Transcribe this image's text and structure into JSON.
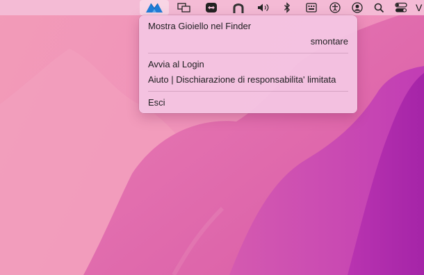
{
  "menubar": {
    "icons": [
      "gioiello-app-icon",
      "display-mirroring-icon",
      "teamviewer-icon",
      "vpn-icon",
      "volume-icon",
      "bluetooth-icon",
      "keyboard-input-icon",
      "accessibility-icon",
      "user-account-icon",
      "spotlight-search-icon",
      "control-center-icon"
    ],
    "clock_partial": "V"
  },
  "menu": {
    "items": [
      {
        "label": "Mostra Gioiello nel Finder"
      },
      {
        "label": "smontare"
      },
      {
        "label": "Avvia al Login"
      },
      {
        "label": "Aiuto | Dischiarazione di responsabilita' limitata"
      },
      {
        "label": "Esci"
      }
    ]
  },
  "colors": {
    "wallpaper_light": "#f29bb8",
    "wallpaper_mid": "#df6aa8",
    "wallpaper_dark": "#b833b0",
    "app_icon_blue": "#1f7ed8"
  }
}
